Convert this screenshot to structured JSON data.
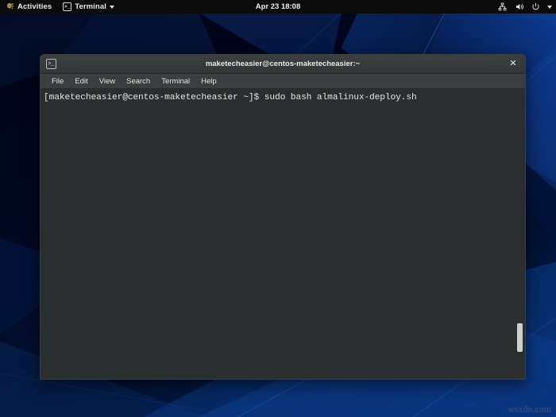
{
  "topbar": {
    "activities_label": "Activities",
    "activities_icon": "gnome-footprint-icon",
    "app_label": "Terminal",
    "app_icon": "terminal-icon",
    "app_caret_icon": "chevron-down-icon",
    "clock": "Apr 23  18:08",
    "status_icons": [
      {
        "name": "network-wired-icon",
        "glyph": "⛓"
      },
      {
        "name": "volume-icon",
        "glyph": "◂)"
      },
      {
        "name": "power-icon",
        "glyph": "⏻"
      },
      {
        "name": "chevron-down-icon",
        "glyph": "▾"
      }
    ],
    "background_color": "#0b0b0b"
  },
  "window": {
    "title": "maketecheasier@centos-maketecheasier:~",
    "titlebar_icon": "terminal-icon",
    "close_label": "✕",
    "titlebar_color": "#3b3f3f",
    "body_color": "#2b2e2e"
  },
  "menubar": {
    "items": [
      {
        "label": "File",
        "name": "menu-file"
      },
      {
        "label": "Edit",
        "name": "menu-edit"
      },
      {
        "label": "View",
        "name": "menu-view"
      },
      {
        "label": "Search",
        "name": "menu-search"
      },
      {
        "label": "Terminal",
        "name": "menu-terminal"
      },
      {
        "label": "Help",
        "name": "menu-help"
      }
    ]
  },
  "terminal": {
    "prompt": "[maketecheasier@centos-maketecheasier ~]$",
    "command": "sudo bash almalinux-deploy.sh",
    "line": "[maketecheasier@centos-maketecheasier ~]$ sudo bash almalinux-deploy.sh",
    "text_color": "#e4e4e4"
  },
  "desktop": {
    "wallpaper_colors": [
      "#000316",
      "#00071f",
      "#001233",
      "#0b3a86"
    ],
    "watermark": "wsxdn.com"
  }
}
